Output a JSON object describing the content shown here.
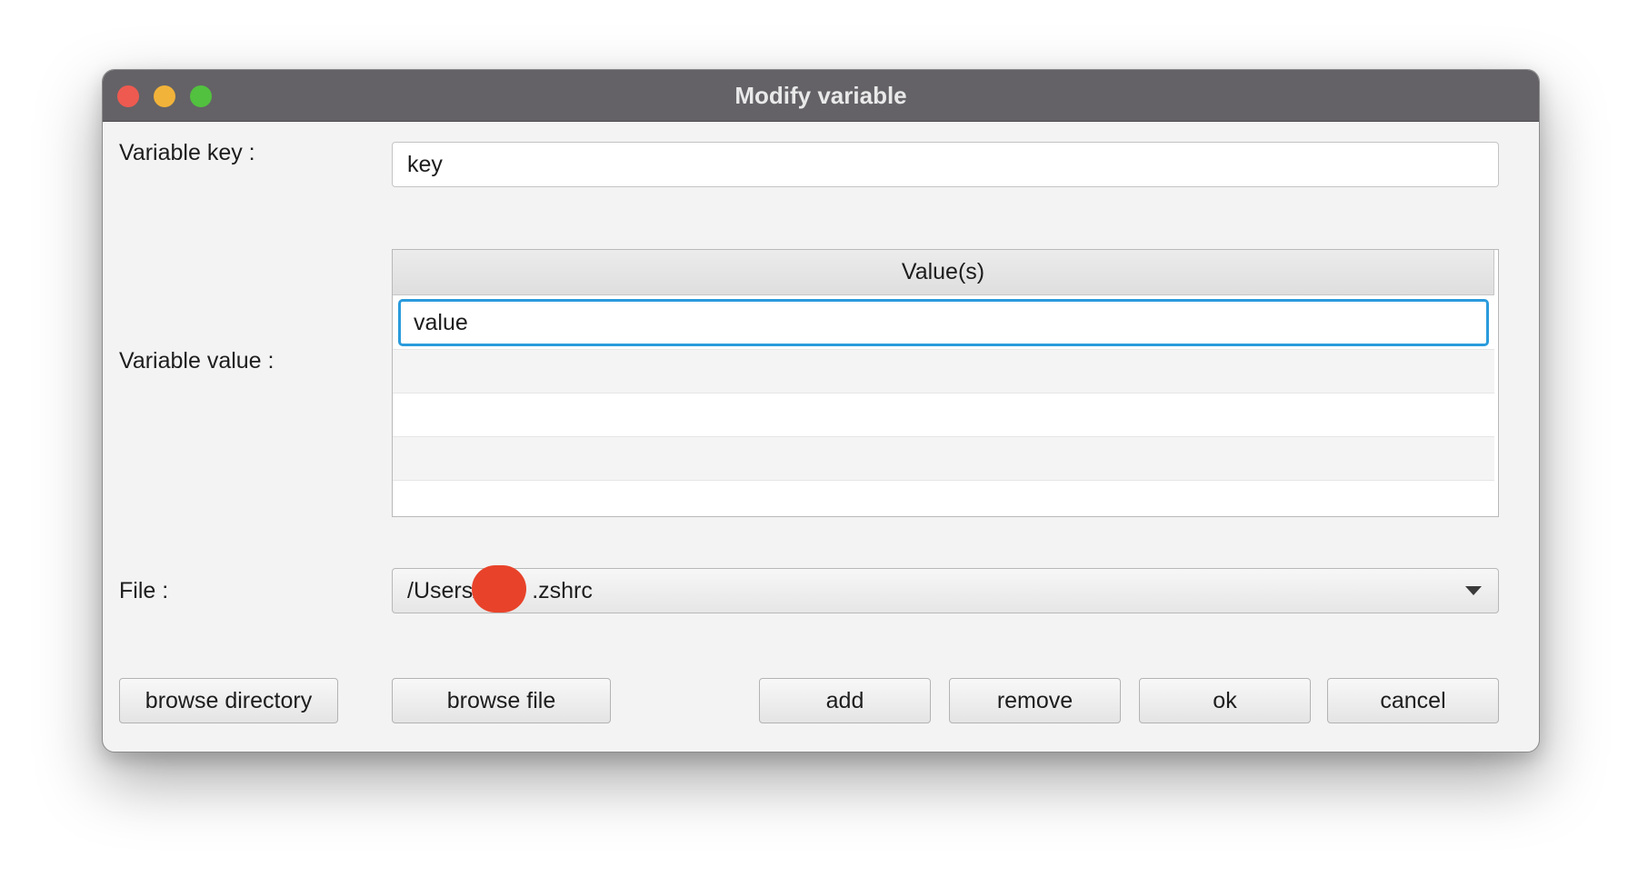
{
  "window": {
    "title": "Modify variable",
    "traffic_lights": [
      "close",
      "minimize",
      "zoom"
    ]
  },
  "form": {
    "key_label": "Variable key :",
    "key_value": "key",
    "value_label": "Variable value :",
    "values_table": {
      "header": "Value(s)",
      "rows": [
        "value",
        "",
        "",
        ""
      ]
    },
    "file_label": "File :",
    "file_prefix": "/Users/",
    "file_suffix": ".zshrc"
  },
  "buttons": {
    "browse_directory": "browse directory",
    "browse_file": "browse file",
    "add": "add",
    "remove": "remove",
    "ok": "ok",
    "cancel": "cancel"
  },
  "colors": {
    "titlebar": "#646266",
    "close": "#ee5a50",
    "minimize": "#f2b33a",
    "zoom": "#52c13f",
    "focus_ring": "#2a9bdc",
    "redaction": "#e8432a"
  }
}
